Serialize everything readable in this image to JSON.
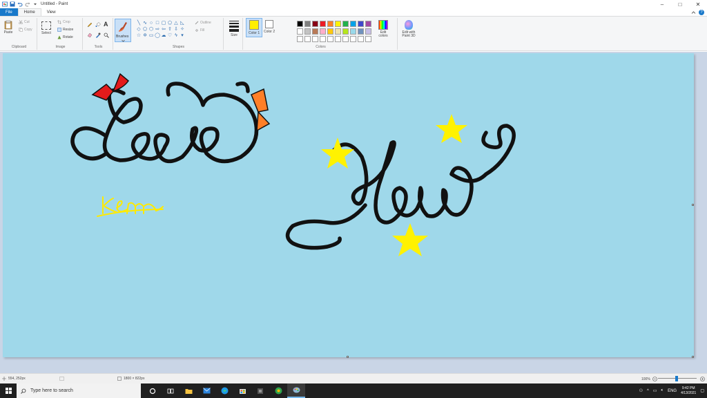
{
  "window": {
    "title": "Untitled - Paint",
    "controls": {
      "minimize": "–",
      "maximize": "□",
      "close": "✕"
    }
  },
  "tabs": [
    {
      "label": "File"
    },
    {
      "label": "Home"
    },
    {
      "label": "View"
    }
  ],
  "ribbon": {
    "clipboard": {
      "paste": "Paste",
      "cut": "Cut",
      "copy": "Copy",
      "label": "Clipboard"
    },
    "image": {
      "select": "Select",
      "crop": "Crop",
      "resize": "Resize",
      "rotate": "Rotate",
      "label": "Image"
    },
    "tools": {
      "label": "Tools",
      "text_tool": "A"
    },
    "brushes": {
      "label": "Brushes"
    },
    "shapes": {
      "outline": "Outline",
      "fill": "Fill",
      "label": "Shapes"
    },
    "size": {
      "label": "Size"
    },
    "colors": {
      "color1_label": "Color 1",
      "color2_label": "Color 2",
      "color1": "#ffef00",
      "color2": "#ffffff",
      "edit_colors": "Edit colors",
      "edit_paint3d": "Edit with Paint 3D",
      "label": "Colors",
      "palette": [
        "#000000",
        "#7f7f7f",
        "#880015",
        "#ed1c24",
        "#ff7f27",
        "#fff200",
        "#22b14c",
        "#00a2e8",
        "#3f48cc",
        "#a349a4",
        "#ffffff",
        "#c3c3c3",
        "#b97a57",
        "#ffaec9",
        "#ffc90e",
        "#efe4b0",
        "#b5e61d",
        "#99d9ea",
        "#7092be",
        "#c8bfe7",
        "#ffffff",
        "#ffffff",
        "#ffffff",
        "#ffffff",
        "#ffffff",
        "#ffffff",
        "#ffffff",
        "#ffffff",
        "#ffffff",
        "#ffffff"
      ]
    }
  },
  "canvas": {
    "background": "#9fd8ea",
    "drawing": {
      "word1": "Love",
      "word2": "You",
      "signature": "kem"
    }
  },
  "status": {
    "cursor_position": "554, 252px",
    "image_size": "1800 × 822px",
    "zoom": "100%"
  },
  "taskbar": {
    "search_placeholder": "Type here to search",
    "language": "ENG",
    "time": "9:42 PM",
    "date": "4/13/2021"
  }
}
